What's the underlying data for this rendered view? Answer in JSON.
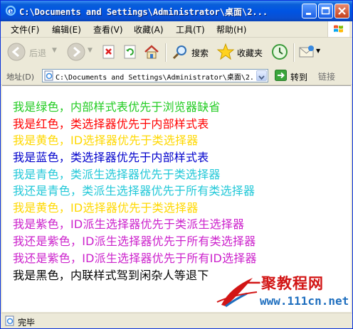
{
  "window": {
    "title": "C:\\Documents and Settings\\Administrator\\桌面\\2..."
  },
  "menu": {
    "items": [
      {
        "label": "文件(F)"
      },
      {
        "label": "编辑(E)"
      },
      {
        "label": "查看(V)"
      },
      {
        "label": "收藏(A)"
      },
      {
        "label": "工具(T)"
      },
      {
        "label": "帮助(H)"
      }
    ]
  },
  "toolbar": {
    "back_label": "后退",
    "search_label": "搜索",
    "favorites_label": "收藏夹"
  },
  "address": {
    "label": "地址(D)",
    "value": "C:\\Documents and Settings\\Administrator\\桌面\\2.",
    "go_label": "转到",
    "links_label": "链接"
  },
  "content": {
    "lines": [
      {
        "text": "我是绿色，内部样式表优先于浏览器缺省",
        "color": "#22cc22"
      },
      {
        "text": "我是红色，类选择器优先于内部样式表",
        "color": "#ff0000"
      },
      {
        "text": "我是黄色，ID选择器优先于类选择器",
        "color": "#ffd800"
      },
      {
        "text": "我是蓝色，类选择器优先于内部样式表",
        "color": "#0000cc"
      },
      {
        "text": "我是青色，类派生选择器优先于类选择器",
        "color": "#22c8d8"
      },
      {
        "text": "我还是青色，类派生选择器优先于所有类选择器",
        "color": "#22c8d8"
      },
      {
        "text": "我是黄色，ID选择器优先于类选择器",
        "color": "#ffd800"
      },
      {
        "text": "我是紫色，ID派生选择器优先于类派生选择器",
        "color": "#cc22cc"
      },
      {
        "text": "我还是紫色，ID派生选择器优先于所有类选择器",
        "color": "#cc22cc"
      },
      {
        "text": "我还是紫色，ID派生选择器优先于所有ID选择器",
        "color": "#cc22cc"
      },
      {
        "text": "我是黑色，内联样式驾到闲杂人等退下",
        "color": "#000000"
      }
    ]
  },
  "watermark": {
    "title": "一聚教程网",
    "url": "www.111cn.net"
  },
  "status": {
    "text": "完毕"
  },
  "colors": {
    "titlebar": "#0054e3",
    "chrome": "#ece9d8"
  }
}
